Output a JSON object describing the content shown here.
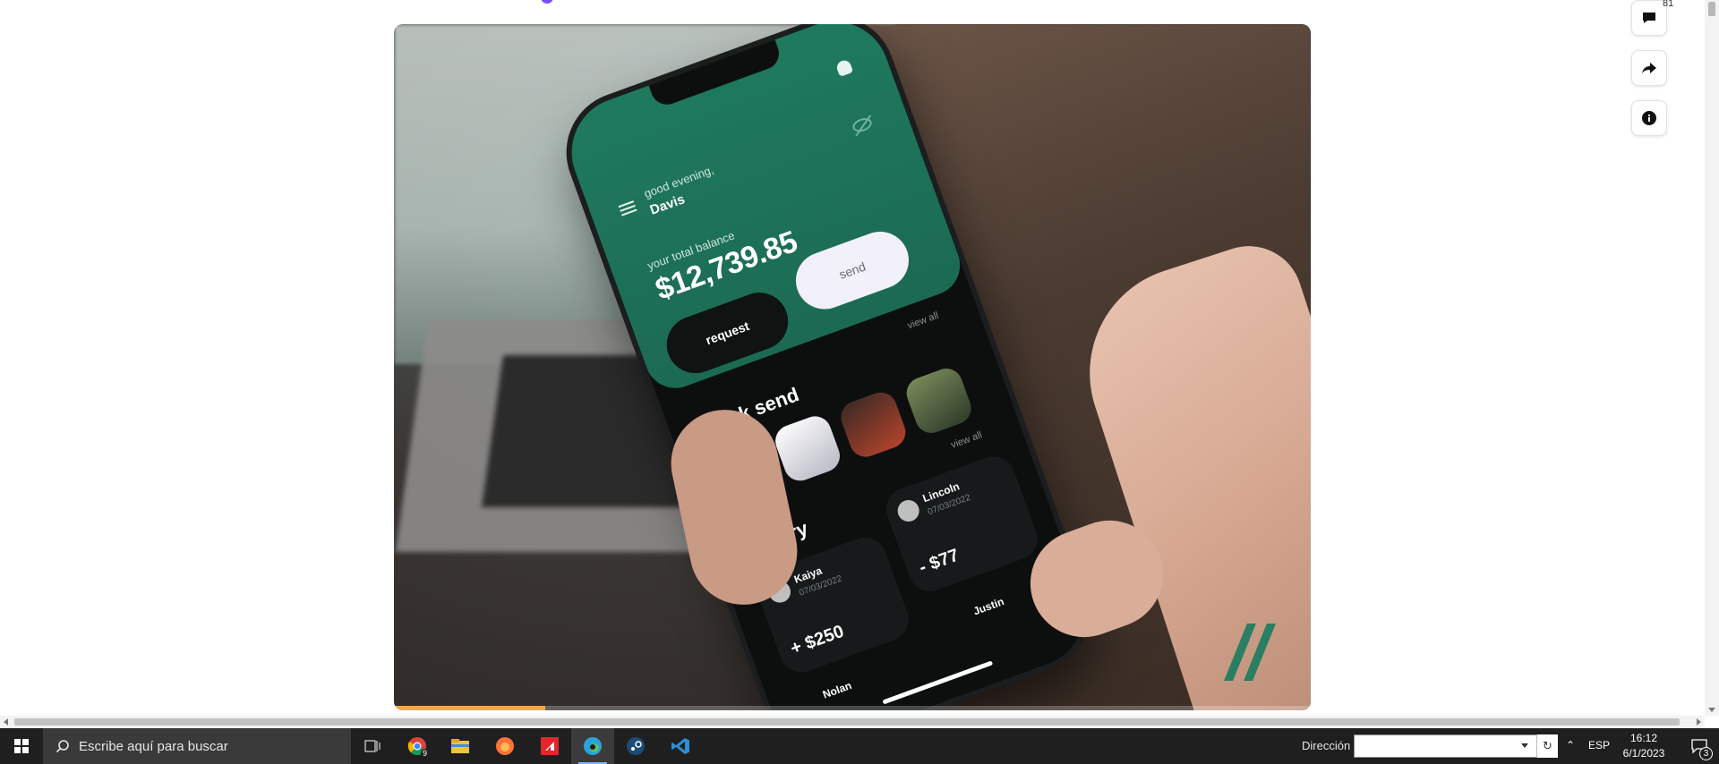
{
  "video": {
    "phone": {
      "greeting": "good evening,",
      "user_name": "Davis",
      "balance_label": "your total balance",
      "balance": "$12,739.85",
      "request_label": "request",
      "send_label": "send",
      "view_all_1": "view all",
      "quick_send_title": "quick send",
      "view_all_2": "view all",
      "history_title": "history",
      "history": [
        {
          "name": "Kaiya",
          "date": "07/03/2022",
          "amount": "+ $250"
        },
        {
          "name": "Lincoln",
          "date": "07/03/2022",
          "amount": "- $77"
        },
        {
          "name": "Nolan"
        },
        {
          "name": "Justin"
        }
      ]
    },
    "progress_fraction": 0.165,
    "progress_color": "#f3a64a"
  },
  "rail": {
    "comment_count": "81",
    "icons": [
      "comment-icon",
      "share-icon",
      "info-icon"
    ]
  },
  "taskbar": {
    "search_placeholder": "Escribe aquí para buscar",
    "chrome_badge": "9",
    "address_label": "Dirección",
    "address_value": "",
    "language": "ESP",
    "time": "16:12",
    "date": "6/1/2023",
    "notification_count": "3",
    "icons": [
      "windows-icon",
      "search-icon",
      "task-view-icon",
      "chrome-icon",
      "file-explorer-icon",
      "firefox-icon",
      "amd-icon",
      "edge-icon",
      "steam-icon",
      "vscode-icon"
    ]
  }
}
